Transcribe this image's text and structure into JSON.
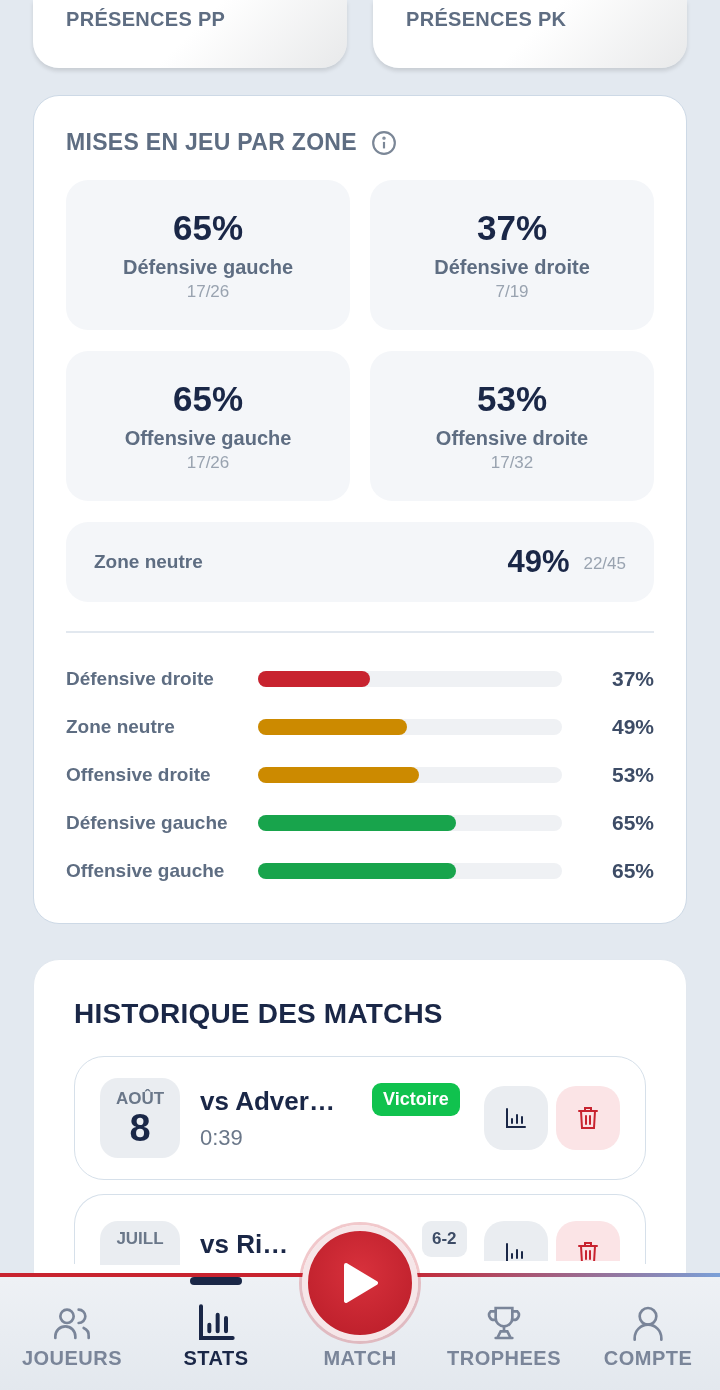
{
  "top_cards": [
    {
      "label": "PRÉSENCES PP"
    },
    {
      "label": "PRÉSENCES PK"
    }
  ],
  "faceoffs": {
    "title": "MISES EN JEU PAR ZONE",
    "tiles": [
      {
        "percent": "65%",
        "zone": "Défensive gauche",
        "ratio": "17/26"
      },
      {
        "percent": "37%",
        "zone": "Défensive droite",
        "ratio": "7/19"
      },
      {
        "percent": "65%",
        "zone": "Offensive gauche",
        "ratio": "17/26"
      },
      {
        "percent": "53%",
        "zone": "Offensive droite",
        "ratio": "17/32"
      }
    ],
    "neutral": {
      "zone": "Zone neutre",
      "percent": "49%",
      "ratio": "22/45"
    },
    "bars": [
      {
        "label": "Défensive droite",
        "level": 0.37,
        "color": "#c8232f",
        "value": "37%"
      },
      {
        "label": "Zone neutre",
        "level": 0.49,
        "color": "#cc8a00",
        "value": "49%"
      },
      {
        "label": "Offensive droite",
        "level": 0.53,
        "color": "#cc8a00",
        "value": "53%"
      },
      {
        "label": "Défensive gauche",
        "level": 0.65,
        "color": "#18a44c",
        "value": "65%"
      },
      {
        "label": "Offensive gauche",
        "level": 0.65,
        "color": "#18a44c",
        "value": "65%"
      }
    ]
  },
  "history": {
    "title": "HISTORIQUE DES MATCHS",
    "matches": [
      {
        "month": "AOÛT",
        "day": "8",
        "opponent": "vs Adver…",
        "time": "0:39",
        "result": "Victoire"
      },
      {
        "month": "JUILL",
        "opponent": "vs Ri…",
        "score": "6-2"
      }
    ]
  },
  "nav": {
    "items": [
      {
        "kind": "players",
        "label": "JOUEURS",
        "selected": false
      },
      {
        "kind": "stats",
        "label": "STATS",
        "selected": true
      },
      {
        "kind": "play",
        "label": "MATCH",
        "selected": false
      },
      {
        "kind": "trophy",
        "label": "TROPHEES",
        "selected": false
      },
      {
        "kind": "account",
        "label": "COMPTE",
        "selected": false
      }
    ]
  }
}
